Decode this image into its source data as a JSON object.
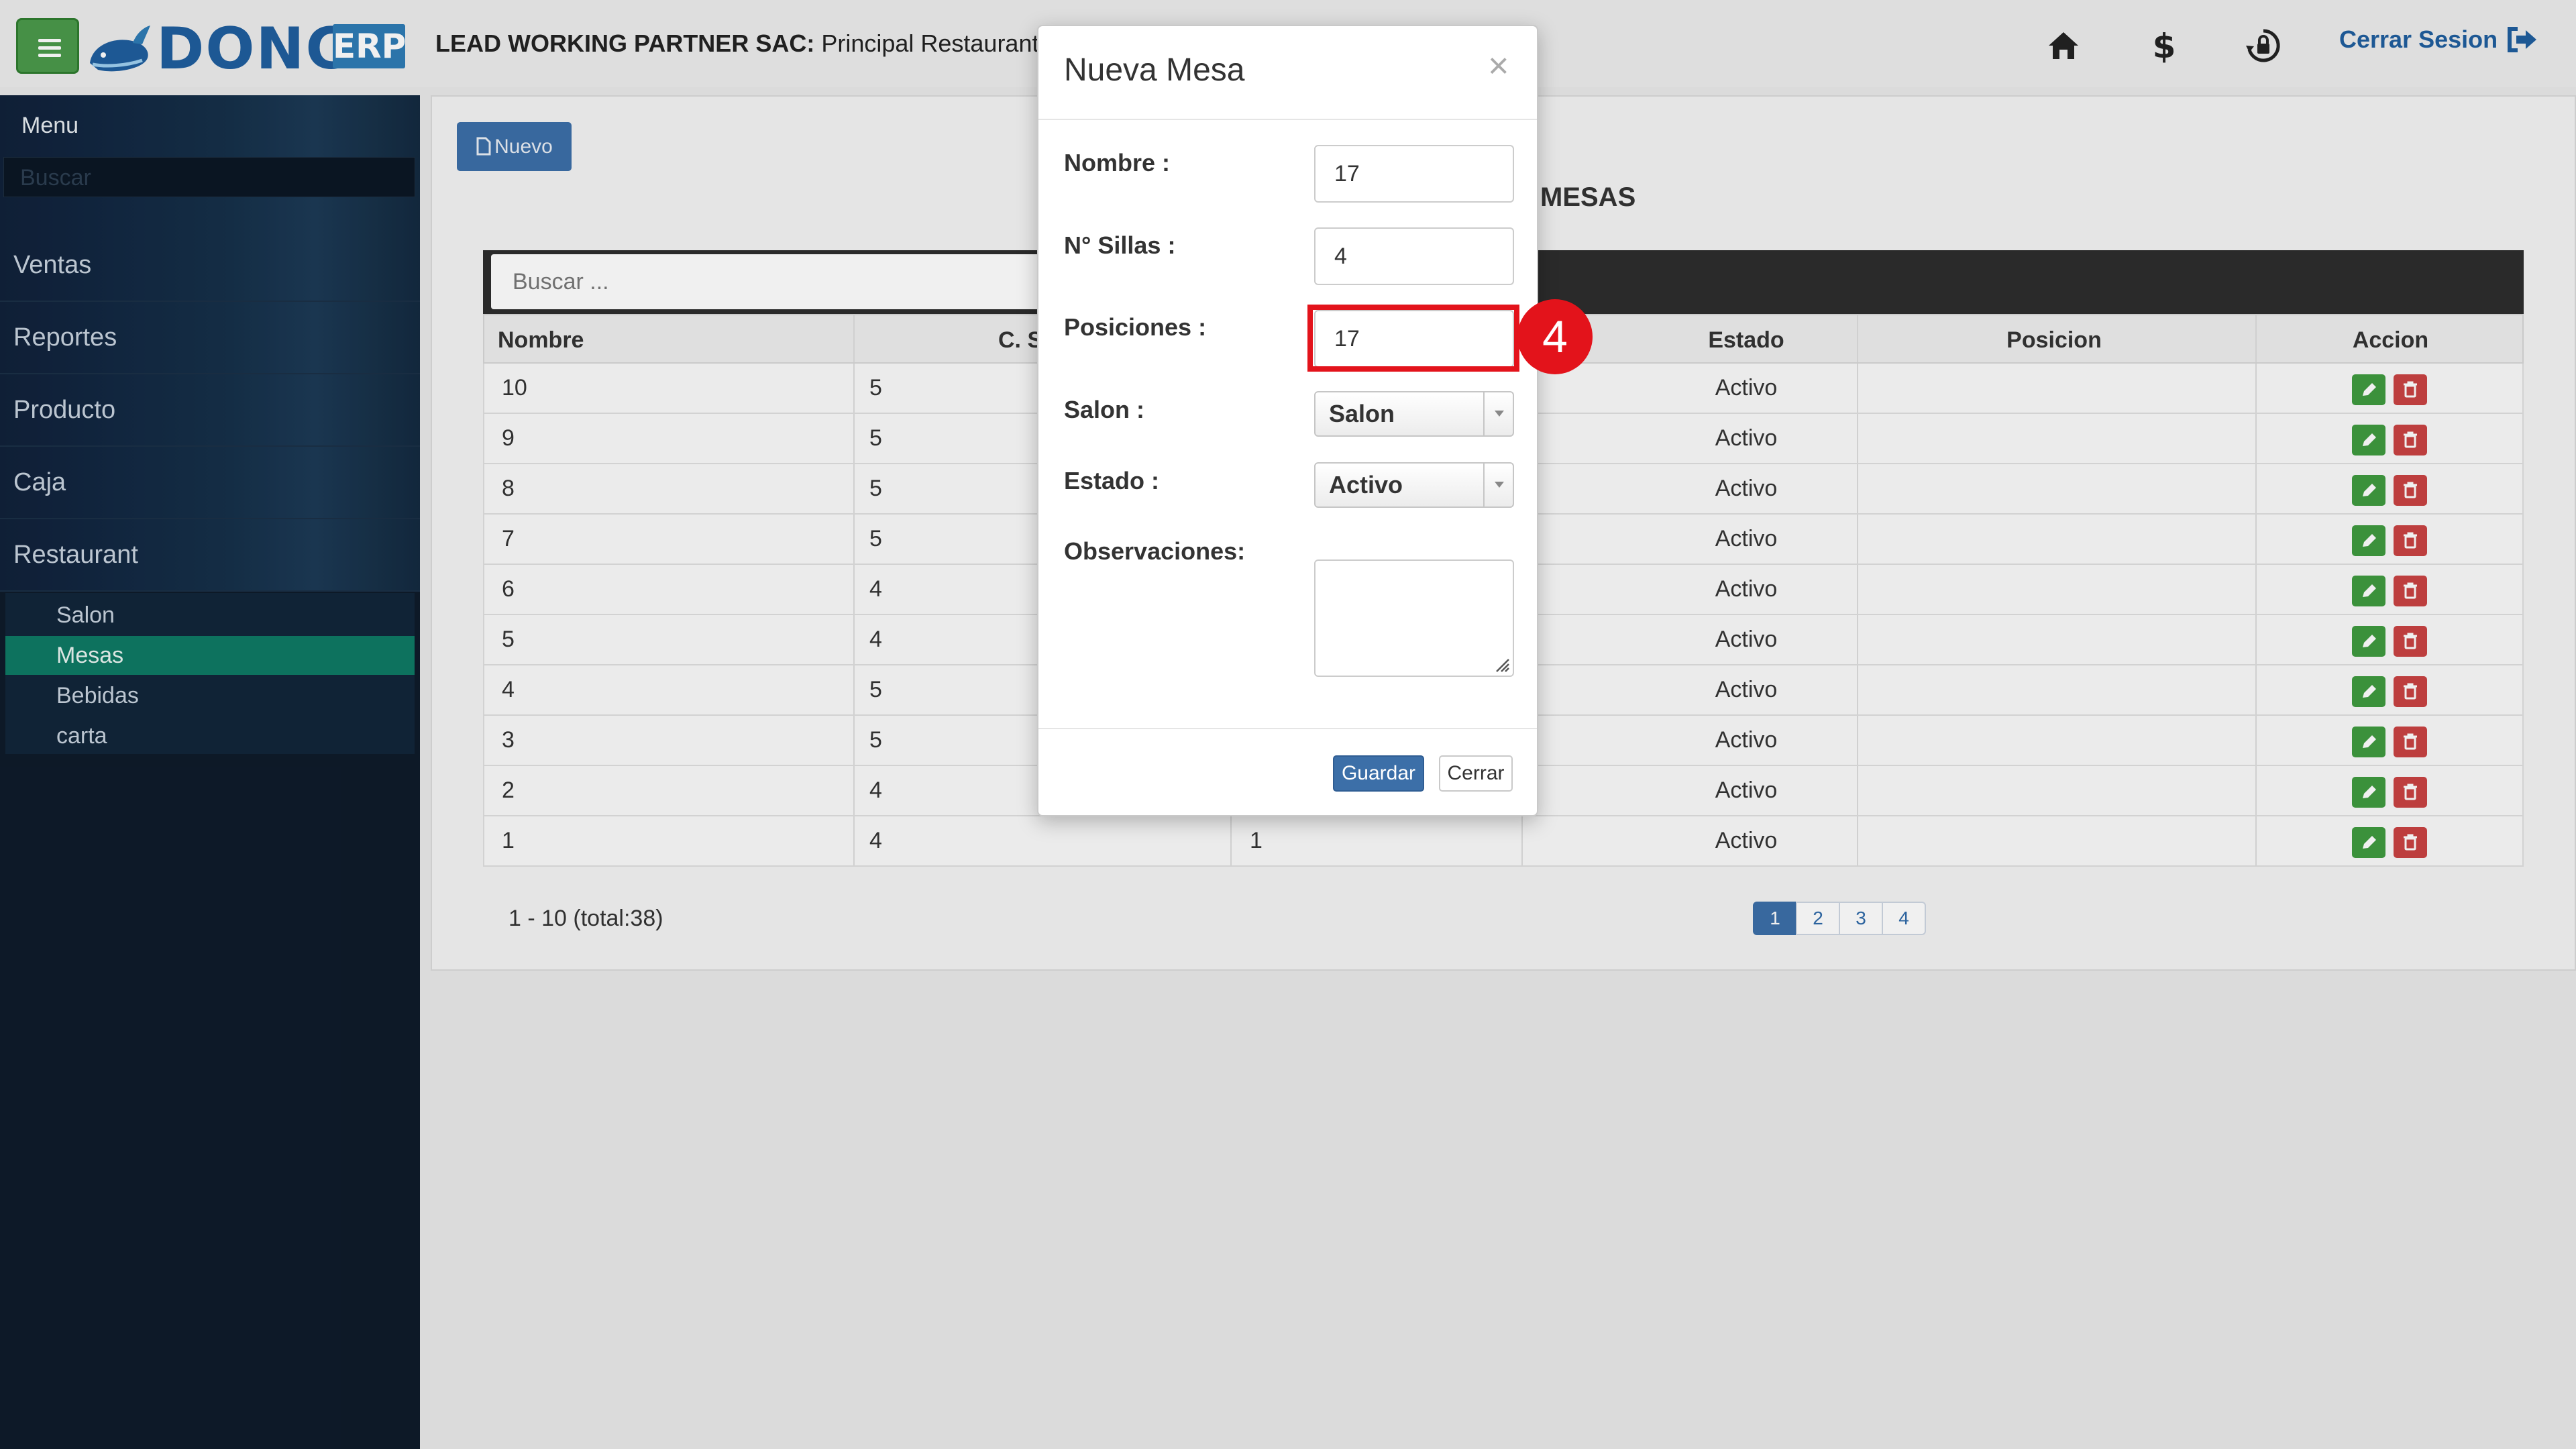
{
  "header": {
    "logo_text": "DONCA",
    "logo_badge": "ERP",
    "company_bold": "LEAD WORKING PARTNER SAC:",
    "company_rest": " Principal Restaurante",
    "logout_label": "Cerrar Sesion",
    "icons": [
      "home-icon",
      "dollar-icon",
      "lock-refresh-icon",
      "sign-out-icon"
    ]
  },
  "sidebar": {
    "title": "Menu",
    "search_placeholder": "Buscar",
    "items": [
      {
        "label": "Ventas"
      },
      {
        "label": "Reportes"
      },
      {
        "label": "Producto"
      },
      {
        "label": "Caja"
      },
      {
        "label": "Restaurant"
      }
    ],
    "subitems": [
      {
        "label": "Salon"
      },
      {
        "label": "Mesas",
        "active": true
      },
      {
        "label": "Bebidas"
      },
      {
        "label": "carta"
      }
    ]
  },
  "main": {
    "new_button": "Nuevo",
    "heading": "MESAS",
    "search_placeholder": "Buscar ...",
    "columns": [
      "Nombre",
      "C. S",
      "Estado",
      "Posicion",
      "Accion"
    ],
    "rows": [
      {
        "nombre": "10",
        "sillas": "5",
        "pos": "",
        "estado": "Activo",
        "posicion": ""
      },
      {
        "nombre": "9",
        "sillas": "5",
        "pos": "",
        "estado": "Activo",
        "posicion": ""
      },
      {
        "nombre": "8",
        "sillas": "5",
        "pos": "",
        "estado": "Activo",
        "posicion": ""
      },
      {
        "nombre": "7",
        "sillas": "5",
        "pos": "",
        "estado": "Activo",
        "posicion": ""
      },
      {
        "nombre": "6",
        "sillas": "4",
        "pos": "",
        "estado": "Activo",
        "posicion": ""
      },
      {
        "nombre": "5",
        "sillas": "4",
        "pos": "",
        "estado": "Activo",
        "posicion": ""
      },
      {
        "nombre": "4",
        "sillas": "5",
        "pos": "",
        "estado": "Activo",
        "posicion": ""
      },
      {
        "nombre": "3",
        "sillas": "5",
        "pos": "",
        "estado": "Activo",
        "posicion": ""
      },
      {
        "nombre": "2",
        "sillas": "4",
        "pos": "",
        "estado": "Activo",
        "posicion": ""
      },
      {
        "nombre": "1",
        "sillas": "4",
        "pos": "1",
        "estado": "Activo",
        "posicion": ""
      }
    ],
    "range_text": "1 - 10 (total:38)",
    "pages": [
      "1",
      "2",
      "3",
      "4"
    ],
    "current_page": "1"
  },
  "modal": {
    "title": "Nueva Mesa",
    "close_symbol": "×",
    "fields": {
      "nombre": {
        "label": "Nombre :",
        "value": "17"
      },
      "sillas": {
        "label": "N° Sillas :",
        "value": "4"
      },
      "posiciones": {
        "label": "Posiciones :",
        "value": "17"
      },
      "salon": {
        "label": "Salon :",
        "value": "Salon"
      },
      "estado": {
        "label": "Estado :",
        "value": "Activo"
      },
      "observaciones": {
        "label": "Observaciones:",
        "value": ""
      }
    },
    "save_label": "Guardar",
    "close_label": "Cerrar"
  },
  "annotation": {
    "step_number": "4",
    "color": "#e3131b"
  },
  "colors": {
    "primary": "#3c6fa8",
    "sidebar_bg": "#0e1b2a",
    "active_menu": "#0e7a64",
    "edit_button": "#3f9b3f",
    "delete_button": "#c94242"
  }
}
